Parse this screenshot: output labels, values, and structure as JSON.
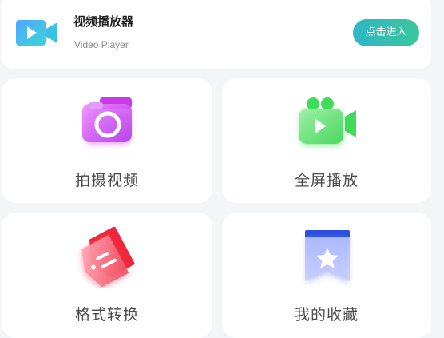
{
  "header": {
    "title": "视频播放器",
    "subtitle": "Video Player",
    "icon": "video-camera-icon",
    "enter_button_label": "点击进入",
    "accent_gradient": [
      "#2fb7c6",
      "#39c79a"
    ]
  },
  "features": [
    {
      "label": "拍摄视频",
      "icon": "camera-icon",
      "color": "#c13cf0"
    },
    {
      "label": "全屏播放",
      "icon": "video-camera-icon",
      "color": "#3fdc5a"
    },
    {
      "label": "格式转换",
      "icon": "tag-icon",
      "color": "#f0263a"
    },
    {
      "label": "我的收藏",
      "icon": "star-bookmark-icon",
      "color": "#2b4ee0"
    }
  ]
}
